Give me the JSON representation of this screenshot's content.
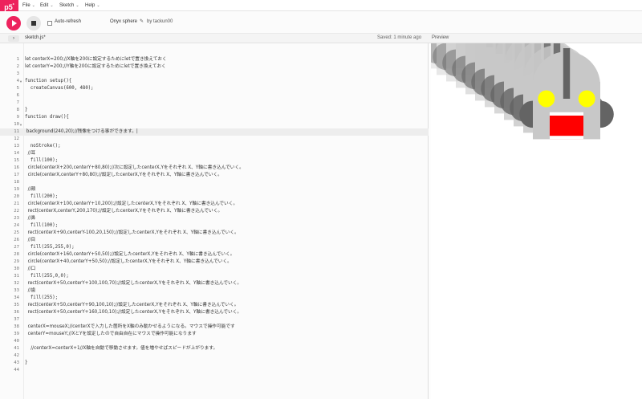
{
  "nav": {
    "logo": "p5",
    "logo_sup": "*",
    "menus": [
      "File",
      "Edit",
      "Sketch",
      "Help"
    ]
  },
  "toolbar": {
    "auto_refresh_label": "Auto-refresh",
    "sketch_name": "Onyx sphere",
    "by_user": "by tackun00"
  },
  "filebar": {
    "file_tab": "sketch.js*",
    "saved_status": "Saved: 1 minute ago",
    "preview_title": "Preview"
  },
  "editor": {
    "active_line": 11,
    "fold_lines": [
      4,
      10
    ],
    "lines": [
      "let centerX=200;//X軸を200に設定するためにletで置き換えておく",
      "let centerY=200;//Y軸を200に設定するためにletで置き換えておく",
      "",
      "function setup(){",
      "  createCanvas(600, 480);",
      "",
      "",
      "}",
      "function draw(){",
      "",
      " background(240,20);//残像をつける事ができます。|",
      "",
      "  noStroke();",
      "  //耳",
      "  fill(100);",
      "  circle(centerX+200,centerY+80,80);//次に設定したcenterX,Yをそれぞれ X、Y軸に書き込んでいく。",
      "  circle(centerX,centerY+80,80);//設定したcenterX,Yをそれぞれ X、Y軸に書き込んでいく。",
      "",
      "  //顔",
      "  fill(200);",
      "  circle(centerX+100,centerY+10,200);//設定したcenterX,Yをそれぞれ X、Y軸に書き込んでいく。",
      "  rect(centerX,centerY,200,170);//設定したcenterX,Yをそれぞれ X、Y軸に書き込んでいく。",
      "  //鼻",
      "  fill(100);",
      "  rect(centerX+90,centerY-100,20,150);//設定したcenterX,Yをそれぞれ X、Y軸に書き込んでいく。",
      "  //目",
      "  fill(255,255,0);",
      "  circle(centerX+160,centerY+50,50);//設定したcenterX,Yをそれぞれ X、Y軸に書き込んでいく。",
      "  circle(centerX+40,centerY+50,50);//設定したcenterX,Yをそれぞれ X、Y軸に書き込んでいく。",
      "  //口",
      "  fill(255,0,0);",
      "  rect(centerX+50,centerY+100,100,70);//設定したcenterX,Yをそれぞれ X、Y軸に書き込んでいく。",
      "  //歯",
      "  fill(255);",
      "  rect(centerX+50,centerY+90,100,10);//設定したcenterX,Yをそれぞれ X、Y軸に書き込んでいく。",
      "  rect(centerX+50,centerY+160,100,10);//設定したcenterX,Yをそれぞれ X、Y軸に書き込んでいく。",
      "",
      "  centerX=mouseX;//centerXで入力した箇所をX軸のみ動かせるようになる。マウスで操作可能です",
      "  centerY=mouseY;//XとYを設定したので自由自在にマウスで操作可能になります",
      "",
      "    //centerX=centerX+1//X軸を自動で移動させます。値を増やせばスピードが上がります。",
      "",
      "}",
      ""
    ]
  },
  "preview_colors": {
    "bg": "#ffffff",
    "ear": "#646464",
    "face": "#c8c8c8",
    "nose": "#646464",
    "eye": "#ffff00",
    "mouth": "#ff0000",
    "teeth": "#ffffff"
  },
  "accent": "#ed225d"
}
